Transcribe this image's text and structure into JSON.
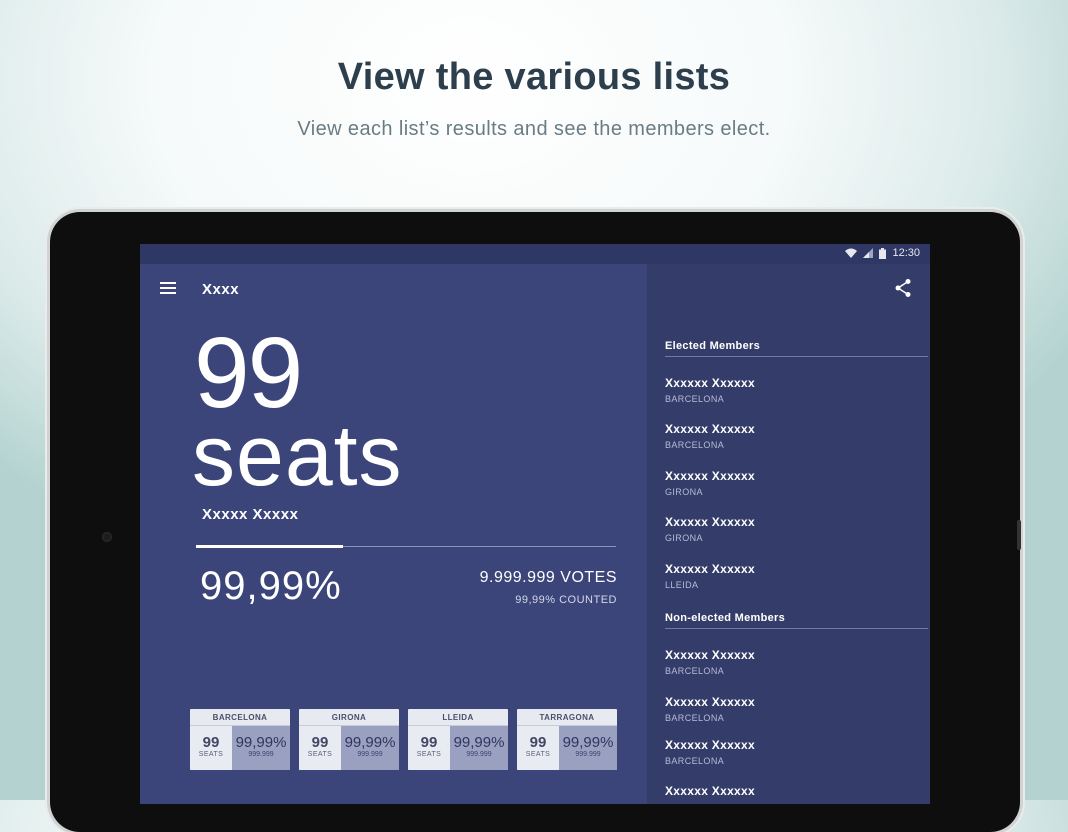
{
  "promo": {
    "headline": "View the various lists",
    "subline": "View each list’s results and see the members elect."
  },
  "status": {
    "time": "12:30"
  },
  "app": {
    "title": "Xxxx"
  },
  "result": {
    "seats_number": "99",
    "seats_word": "seats",
    "list_name": "Xxxxx Xxxxx",
    "percent": "99,99%",
    "progress": 0.35,
    "votes": "9.999.999 VOTES",
    "counted": "99,99% COUNTED"
  },
  "regions": [
    {
      "name": "BARCELONA",
      "seats": "99",
      "seats_label": "SEATS",
      "percent": "99,99%",
      "votes": "999.999"
    },
    {
      "name": "GIRONA",
      "seats": "99",
      "seats_label": "SEATS",
      "percent": "99,99%",
      "votes": "999.999"
    },
    {
      "name": "LLEIDA",
      "seats": "99",
      "seats_label": "SEATS",
      "percent": "99,99%",
      "votes": "999.999"
    },
    {
      "name": "TARRAGONA",
      "seats": "99",
      "seats_label": "SEATS",
      "percent": "99,99%",
      "votes": "999.999"
    }
  ],
  "members": {
    "elected_title": "Elected Members",
    "elected": [
      {
        "name": "Xxxxxx Xxxxxx",
        "city": "BARCELONA"
      },
      {
        "name": "Xxxxxx Xxxxxx",
        "city": "BARCELONA"
      },
      {
        "name": "Xxxxxx Xxxxxx",
        "city": "GIRONA"
      },
      {
        "name": "Xxxxxx Xxxxxx",
        "city": "GIRONA"
      },
      {
        "name": "Xxxxxx Xxxxxx",
        "city": "LLEIDA"
      }
    ],
    "non_elected_title": "Non-elected Members",
    "non_elected": [
      {
        "name": "Xxxxxx Xxxxxx",
        "city": "BARCELONA"
      },
      {
        "name": "Xxxxxx Xxxxxx",
        "city": "BARCELONA"
      },
      {
        "name": "Xxxxxx Xxxxxx",
        "city": "BARCELONA"
      },
      {
        "name": "Xxxxxx Xxxxxx",
        "city": ""
      }
    ]
  },
  "icons": {
    "menu": "menu-icon",
    "share": "share-icon",
    "wifi": "wifi-icon",
    "signal": "signal-icon",
    "battery": "battery-icon"
  },
  "colors": {
    "primary": "#3b4579",
    "sidebar": "#343d6a",
    "statusbar": "#2f3764",
    "headline": "#2d3e4c"
  }
}
